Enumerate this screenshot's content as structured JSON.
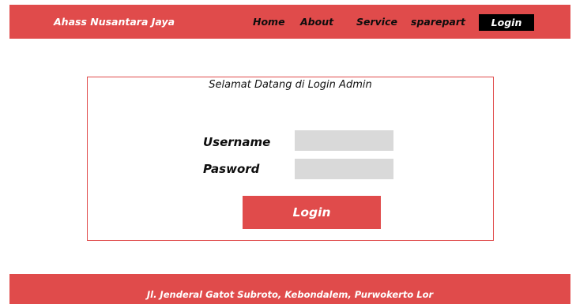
{
  "navbar": {
    "brand": "Ahass Nusantara Jaya",
    "links": [
      {
        "label": "Home"
      },
      {
        "label": "About"
      },
      {
        "label": "Service"
      },
      {
        "label": "sparepart"
      }
    ],
    "login_label": "Login"
  },
  "panel": {
    "title": "Selamat Datang di Login Admin",
    "username_label": "Username",
    "username_value": "",
    "password_label": "Pasword",
    "password_value": "",
    "submit_label": "Login"
  },
  "footer": {
    "address": "Jl. Jenderal Gatot Subroto, Kebondalem, Purwokerto Lor"
  },
  "colors": {
    "accent": "#e04b4b",
    "input_bg": "#d9d9d9",
    "nav_login_bg": "#000000",
    "text_dark": "#0d0d0d",
    "text_light": "#ffffff"
  }
}
